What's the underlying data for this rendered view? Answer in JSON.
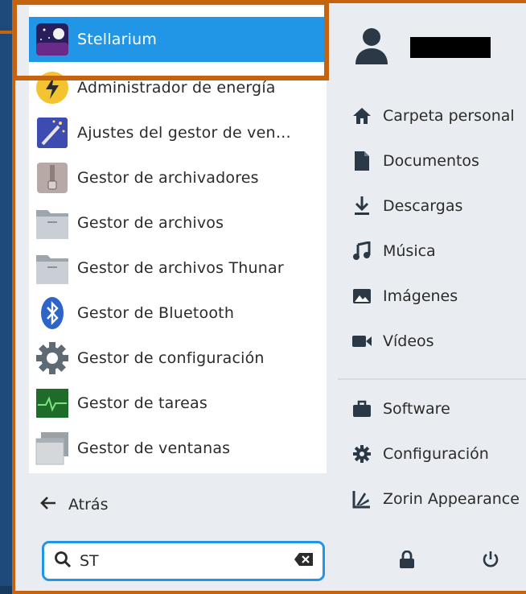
{
  "menu": {
    "apps": [
      {
        "label": "Stellarium",
        "icon": "stellarium-icon",
        "selected": true
      },
      {
        "label": "Administrador de energía",
        "icon": "power-manager-icon"
      },
      {
        "label": "Ajustes del gestor de ven…",
        "icon": "window-manager-tweaks-icon"
      },
      {
        "label": "Gestor de archivadores",
        "icon": "archive-manager-icon"
      },
      {
        "label": "Gestor de archivos",
        "icon": "file-manager-icon"
      },
      {
        "label": "Gestor de archivos Thunar",
        "icon": "thunar-icon"
      },
      {
        "label": "Gestor de Bluetooth",
        "icon": "bluetooth-icon"
      },
      {
        "label": "Gestor de configuración",
        "icon": "settings-manager-icon"
      },
      {
        "label": "Gestor de tareas",
        "icon": "task-manager-icon"
      },
      {
        "label": "Gestor de ventanas",
        "icon": "window-manager-icon"
      }
    ],
    "back_label": "Atrás",
    "search": {
      "value": "ST"
    }
  },
  "places": [
    {
      "label": "Carpeta personal",
      "icon": "home-icon"
    },
    {
      "label": "Documentos",
      "icon": "document-icon"
    },
    {
      "label": "Descargas",
      "icon": "download-icon"
    },
    {
      "label": "Música",
      "icon": "music-icon"
    },
    {
      "label": "Imágenes",
      "icon": "image-icon"
    },
    {
      "label": "Vídeos",
      "icon": "video-icon"
    }
  ],
  "system": [
    {
      "label": "Software",
      "icon": "briefcase-icon"
    },
    {
      "label": "Configuración",
      "icon": "gear-icon"
    },
    {
      "label": "Zorin Appearance",
      "icon": "zorin-appearance-icon"
    }
  ],
  "colors": {
    "accent": "#2196e6",
    "highlight_border": "#c5630f",
    "panel": "#e9edf1"
  }
}
